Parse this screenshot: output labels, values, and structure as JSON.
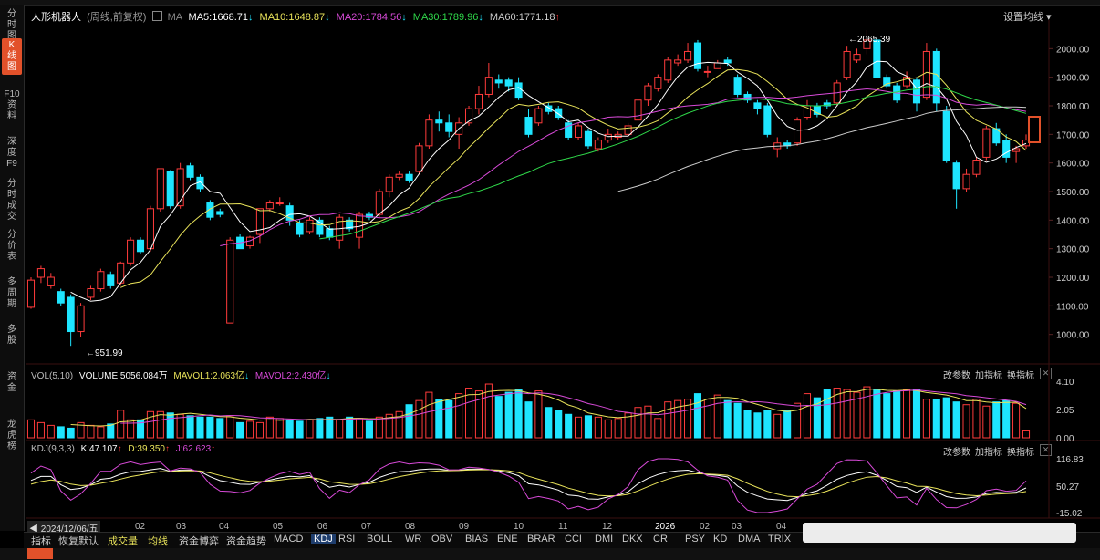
{
  "sidebar": [
    {
      "label": "分时图",
      "active": false
    },
    {
      "label": "K线图",
      "active": true
    },
    {
      "label": "F10资料",
      "active": false
    },
    {
      "label": "深度F9",
      "active": false
    },
    {
      "label": "分时成交",
      "active": false
    },
    {
      "label": "分价表",
      "active": false
    },
    {
      "label": "多周期",
      "active": false
    },
    {
      "label": "多股",
      "active": false
    },
    {
      "label": "资金",
      "active": false
    },
    {
      "label": "龙虎榜",
      "active": false
    }
  ],
  "header": {
    "stock_name": "人形机器人",
    "mode": "(周线,前复权)",
    "ma_label": "MA",
    "ma5": "MA5:1668.71",
    "ma10": "MA10:1648.87",
    "ma20": "MA20:1784.56",
    "ma30": "MA30:1789.96",
    "ma60": "MA60:1771.18",
    "arrow_down": "↓",
    "arrow_up": "↑",
    "settings": "设置均线"
  },
  "price_axis": [
    "2000.00",
    "1900.00",
    "1800.00",
    "1700.00",
    "1600.00",
    "1500.00",
    "1400.00",
    "1300.00",
    "1200.00",
    "1100.00",
    "1000.00"
  ],
  "annotations": {
    "high": "←2065.39",
    "low": "←951.99"
  },
  "vol_panel": {
    "title": "VOL(5,10)",
    "volume": "VOLUME:5056.084万",
    "mavol1": "MAVOL1:2.063亿",
    "mavol2": "MAVOL2:2.430亿",
    "axis": [
      "4.10",
      "2.05",
      "0.00"
    ],
    "btn_params": "改参数",
    "btn_add": "加指标",
    "btn_switch": "换指标"
  },
  "kdj_panel": {
    "title": "KDJ(9,3,3)",
    "k": "K:47.107",
    "d": "D:39.350",
    "j": "J:62.623",
    "axis": [
      "116.83",
      "50.27",
      "-15.02"
    ],
    "btn_params": "改参数",
    "btn_add": "加指标",
    "btn_switch": "换指标"
  },
  "time_axis": {
    "current": "2024/12/06/五",
    "labels": [
      "02",
      "03",
      "04",
      "05",
      "06",
      "07",
      "08",
      "09",
      "10",
      "11",
      "12",
      "2026",
      "02",
      "03",
      "04"
    ]
  },
  "indicator_tabs": [
    "指标",
    "恢复默认",
    "成交量",
    "均线",
    "资金博弈",
    "资金趋势",
    "MACD",
    "KDJ",
    "RSI",
    "BOLL",
    "WR",
    "OBV",
    "BIAS",
    "ENE",
    "BRAR",
    "CCI",
    "DMI",
    "DKX",
    "CR",
    "PSY",
    "KD",
    "DMA",
    "TRIX"
  ],
  "active_tab": "KDJ",
  "colors": {
    "up": "#ff3b3b",
    "down": "#1ee5ff",
    "ma5": "#ffffff",
    "ma10": "#e9e35a",
    "ma20": "#d84ad8",
    "ma30": "#2fd84a",
    "ma60": "#cccccc",
    "accent": "#e2512a"
  },
  "chart_data": {
    "type": "candlestick",
    "ylim": [
      900,
      2100
    ],
    "candles": [
      [
        1095,
        1190,
        1090,
        1200
      ],
      [
        1200,
        1230,
        1180,
        1240
      ],
      [
        1170,
        1200,
        1160,
        1215
      ],
      [
        1150,
        1110,
        1100,
        1160
      ],
      [
        1130,
        1010,
        960,
        1140
      ],
      [
        1010,
        1100,
        990,
        1110
      ],
      [
        1130,
        1160,
        1120,
        1170
      ],
      [
        1160,
        1220,
        1150,
        1230
      ],
      [
        1210,
        1170,
        1160,
        1220
      ],
      [
        1180,
        1250,
        1170,
        1255
      ],
      [
        1250,
        1330,
        1240,
        1340
      ],
      [
        1330,
        1290,
        1280,
        1340
      ],
      [
        1300,
        1440,
        1290,
        1450
      ],
      [
        1440,
        1580,
        1430,
        1580
      ],
      [
        1570,
        1450,
        1440,
        1575
      ],
      [
        1450,
        1580,
        1440,
        1600
      ],
      [
        1590,
        1550,
        1540,
        1600
      ],
      [
        1550,
        1510,
        1500,
        1560
      ],
      [
        1460,
        1410,
        1400,
        1470
      ],
      [
        1430,
        1420,
        1410,
        1440
      ],
      [
        1040,
        1330,
        1050,
        1340
      ],
      [
        1340,
        1300,
        1300,
        1350
      ],
      [
        1310,
        1340,
        1300,
        1345
      ],
      [
        1350,
        1440,
        1320,
        1440
      ],
      [
        1440,
        1460,
        1430,
        1470
      ],
      [
        1460,
        1460,
        1450,
        1480
      ],
      [
        1450,
        1400,
        1380,
        1460
      ],
      [
        1390,
        1350,
        1340,
        1400
      ],
      [
        1360,
        1400,
        1350,
        1410
      ],
      [
        1400,
        1350,
        1340,
        1410
      ],
      [
        1370,
        1340,
        1330,
        1380
      ],
      [
        1330,
        1410,
        1300,
        1420
      ],
      [
        1400,
        1370,
        1360,
        1410
      ],
      [
        1340,
        1420,
        1300,
        1430
      ],
      [
        1420,
        1410,
        1400,
        1430
      ],
      [
        1420,
        1500,
        1410,
        1510
      ],
      [
        1500,
        1550,
        1480,
        1560
      ],
      [
        1550,
        1560,
        1540,
        1570
      ],
      [
        1560,
        1540,
        1530,
        1570
      ],
      [
        1570,
        1660,
        1560,
        1670
      ],
      [
        1660,
        1750,
        1650,
        1770
      ],
      [
        1750,
        1740,
        1710,
        1780
      ],
      [
        1740,
        1710,
        1690,
        1770
      ],
      [
        1700,
        1740,
        1650,
        1760
      ],
      [
        1740,
        1790,
        1730,
        1800
      ],
      [
        1790,
        1840,
        1770,
        1870
      ],
      [
        1840,
        1900,
        1830,
        1950
      ],
      [
        1890,
        1880,
        1860,
        1910
      ],
      [
        1890,
        1870,
        1850,
        1900
      ],
      [
        1880,
        1830,
        1820,
        1900
      ],
      [
        1760,
        1700,
        1690,
        1790
      ],
      [
        1740,
        1790,
        1730,
        1800
      ],
      [
        1800,
        1780,
        1770,
        1810
      ],
      [
        1790,
        1760,
        1750,
        1800
      ],
      [
        1740,
        1690,
        1680,
        1750
      ],
      [
        1690,
        1730,
        1680,
        1740
      ],
      [
        1710,
        1660,
        1650,
        1720
      ],
      [
        1650,
        1680,
        1640,
        1690
      ],
      [
        1680,
        1700,
        1670,
        1720
      ],
      [
        1690,
        1700,
        1680,
        1710
      ],
      [
        1700,
        1730,
        1690,
        1740
      ],
      [
        1750,
        1820,
        1740,
        1830
      ],
      [
        1820,
        1870,
        1800,
        1880
      ],
      [
        1860,
        1900,
        1850,
        1910
      ],
      [
        1890,
        1960,
        1880,
        1970
      ],
      [
        1950,
        1960,
        1940,
        1980
      ],
      [
        1960,
        1990,
        1950,
        2020
      ],
      [
        2020,
        1930,
        1920,
        2030
      ],
      [
        1920,
        1920,
        1900,
        1940
      ],
      [
        1930,
        1950,
        1930,
        1960
      ],
      [
        1960,
        1950,
        1940,
        1970
      ],
      [
        1900,
        1840,
        1830,
        1910
      ],
      [
        1840,
        1820,
        1810,
        1850
      ],
      [
        1810,
        1790,
        1770,
        1820
      ],
      [
        1800,
        1700,
        1690,
        1810
      ],
      [
        1650,
        1670,
        1620,
        1690
      ],
      [
        1670,
        1660,
        1650,
        1680
      ],
      [
        1670,
        1750,
        1660,
        1760
      ],
      [
        1760,
        1800,
        1750,
        1820
      ],
      [
        1800,
        1770,
        1760,
        1810
      ],
      [
        1810,
        1800,
        1790,
        1820
      ],
      [
        1810,
        1880,
        1800,
        1890
      ],
      [
        1900,
        1990,
        1890,
        2010
      ],
      [
        1960,
        1980,
        1950,
        2000
      ],
      [
        2000,
        2030,
        1980,
        2065
      ],
      [
        2030,
        1900,
        1900,
        2040
      ],
      [
        1900,
        1870,
        1860,
        1910
      ],
      [
        1870,
        1820,
        1810,
        1880
      ],
      [
        1870,
        1900,
        1860,
        1920
      ],
      [
        1890,
        1810,
        1780,
        1900
      ],
      [
        1830,
        1990,
        1820,
        2020
      ],
      [
        1990,
        1810,
        1780,
        2000
      ],
      [
        1780,
        1610,
        1600,
        1800
      ],
      [
        1600,
        1510,
        1440,
        1610
      ],
      [
        1510,
        1560,
        1500,
        1580
      ],
      [
        1560,
        1610,
        1550,
        1620
      ],
      [
        1620,
        1720,
        1610,
        1730
      ],
      [
        1720,
        1670,
        1660,
        1740
      ],
      [
        1680,
        1620,
        1600,
        1700
      ],
      [
        1640,
        1650,
        1600,
        1660
      ],
      [
        1660,
        1680,
        1650,
        1700
      ]
    ],
    "volumes": [
      1.3,
      1.1,
      0.9,
      0.8,
      0.7,
      1.1,
      0.9,
      0.8,
      1.0,
      2.0,
      1.3,
      1.3,
      1.9,
      1.9,
      1.8,
      1.7,
      1.6,
      1.5,
      1.5,
      1.4,
      1.6,
      1.1,
      1.2,
      1.1,
      1.5,
      1.4,
      1.3,
      1.2,
      1.3,
      1.4,
      1.5,
      1.3,
      1.5,
      1.4,
      1.2,
      1.5,
      1.7,
      1.9,
      2.4,
      2.7,
      3.3,
      2.8,
      2.7,
      3.2,
      3.6,
      3.4,
      3.9,
      3.0,
      3.3,
      3.5,
      2.6,
      3.4,
      2.2,
      2.0,
      1.7,
      1.5,
      1.6,
      1.5,
      1.3,
      1.4,
      1.8,
      2.2,
      2.3,
      1.4,
      2.6,
      2.7,
      2.8,
      3.2,
      2.8,
      3.1,
      2.7,
      2.5,
      2.0,
      1.8,
      2.0,
      1.7,
      2.0,
      2.5,
      3.2,
      2.9,
      3.5,
      3.6,
      3.5,
      3.3,
      3.7,
      3.5,
      3.2,
      3.4,
      3.5,
      3.5,
      2.8,
      2.8,
      2.9,
      2.6,
      2.4,
      2.8,
      2.3,
      2.6,
      2.7,
      2.5,
      0.5
    ]
  }
}
